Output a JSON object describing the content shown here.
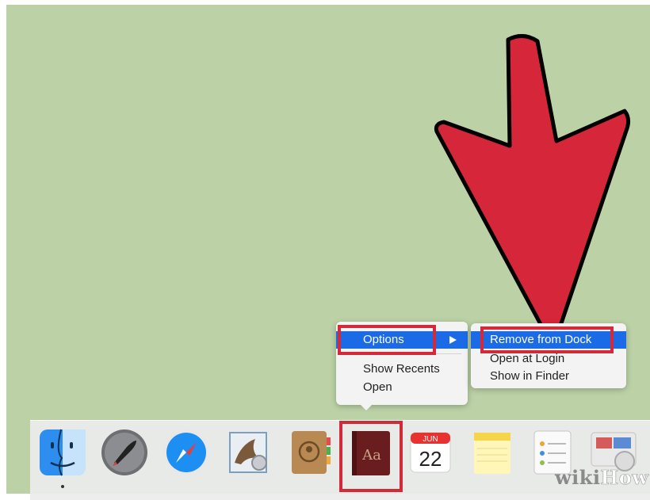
{
  "context_menu": {
    "options_label": "Options",
    "show_recents_label": "Show Recents",
    "open_label": "Open"
  },
  "submenu": {
    "remove_from_dock_label": "Remove from Dock",
    "open_at_login_label": "Open at Login",
    "show_in_finder_label": "Show in Finder"
  },
  "dock": {
    "apps": [
      "finder-icon",
      "launchpad-icon",
      "safari-icon",
      "mail-icon",
      "contacts-icon",
      "dictionary-icon",
      "calendar-icon",
      "notes-icon",
      "reminders-icon",
      "photo-booth-icon"
    ],
    "calendar_month": "JUN",
    "calendar_day": "22",
    "dictionary_glyph": "Aa"
  },
  "watermark": {
    "part1": "wiki",
    "part2": "How"
  },
  "colors": {
    "desktop": "#bcd2a6",
    "menu_selection": "#1b6ae6",
    "highlight_box": "#d22a38",
    "arrow_fill": "#d6263a"
  }
}
